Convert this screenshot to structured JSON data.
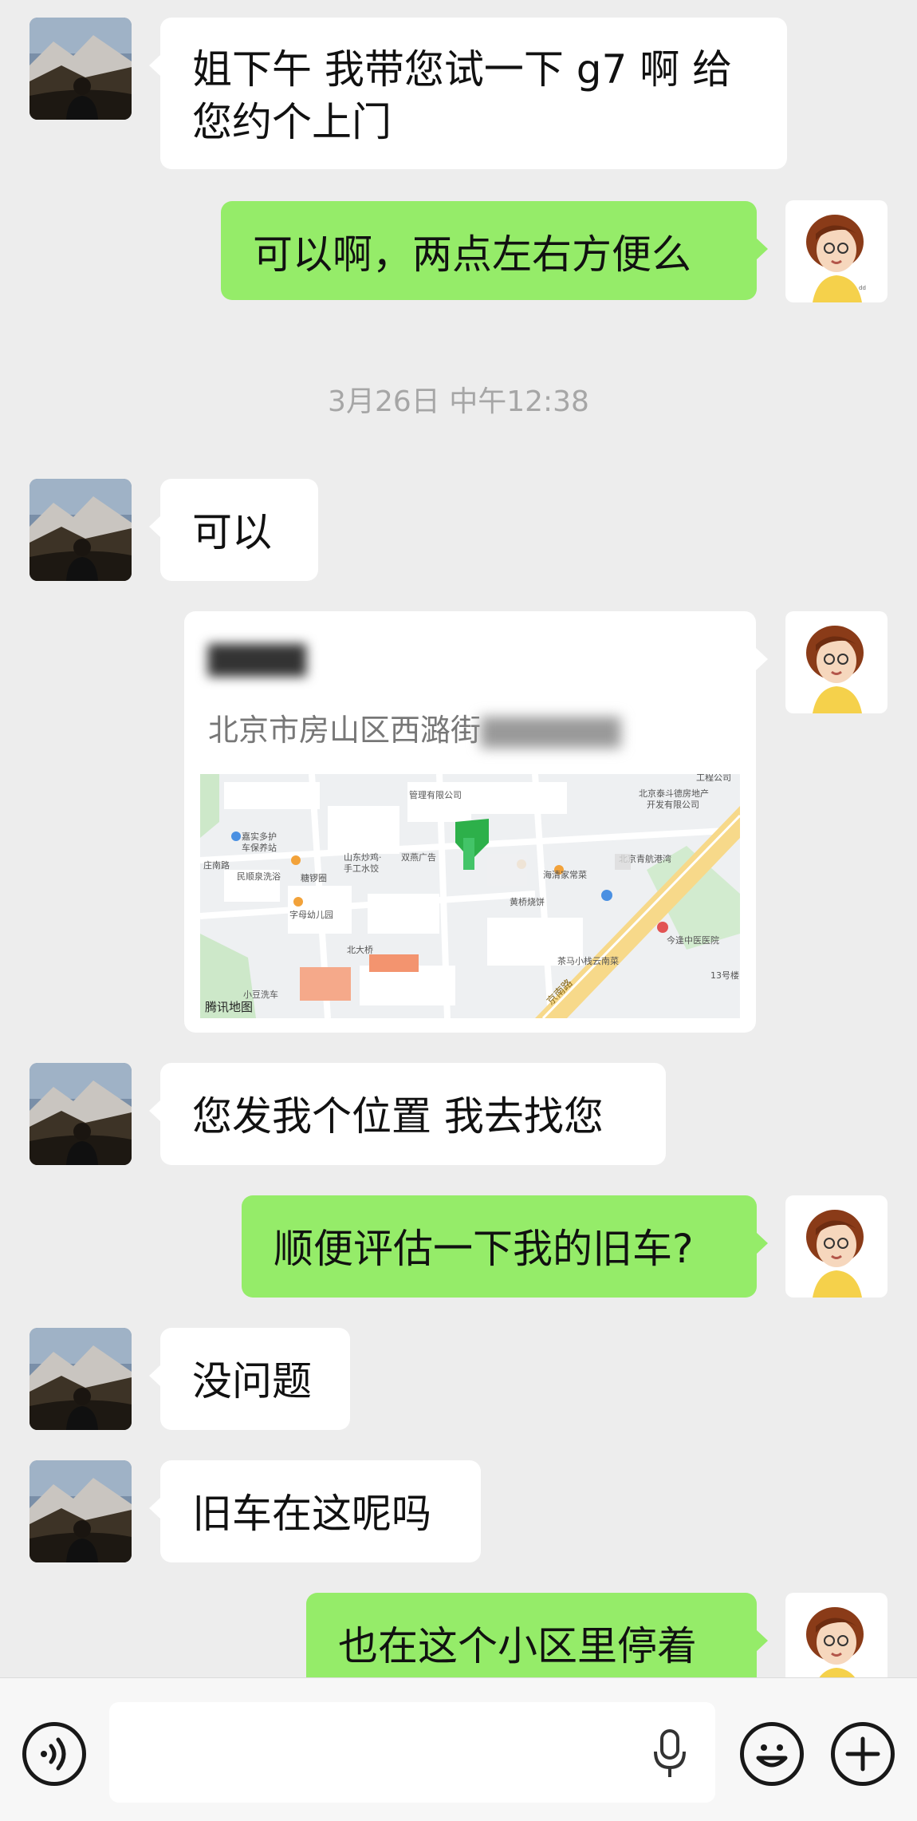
{
  "messages": [
    {
      "id": "m1",
      "side": "in",
      "text_line1": "姐下午 我带您试一下 g7 啊 给",
      "text_line2": "您约个上门"
    },
    {
      "id": "m2",
      "side": "out",
      "text": "可以啊，两点左右方便么"
    },
    {
      "id": "m3",
      "side": "in",
      "text": "可以"
    },
    {
      "id": "m4",
      "side": "out",
      "type": "location",
      "name": "▇▇▇▇",
      "address_visible": "北京市房山区西潞街",
      "address_hidden": "▇▇▇▇▇▇",
      "map_brand": "腾讯地图"
    },
    {
      "id": "m5",
      "side": "in",
      "text": "您发我个位置 我去找您"
    },
    {
      "id": "m6",
      "side": "out",
      "text": "顺便评估一下我的旧车?"
    },
    {
      "id": "m7",
      "side": "in",
      "text": "没问题"
    },
    {
      "id": "m8",
      "side": "in",
      "text": "旧车在这呢吗"
    },
    {
      "id": "m9",
      "side": "out",
      "text": "也在这个小区里停着"
    }
  ],
  "timestamp": "3月26日 中午12:38",
  "map_labels": {
    "l1": "管理有限公司",
    "l2": "嘉实多护\n车保养站",
    "l3": "庄南路",
    "l4": "民顺泉洗浴",
    "l5": "山东炒鸡·\n手工水饺",
    "l6": "双燕广告",
    "l7": "糖锣圈",
    "l8": "字母幼儿园",
    "l9": "北大桥",
    "l10": "小豆洗车",
    "l11": "工程公司",
    "l12": "北京泰斗德房地产\n开发有限公司",
    "l13": "海清家常菜",
    "l14": "黄桥烧饼",
    "l15": "茶马小栈云南菜",
    "l16": "今逢中医医院",
    "l17": "京南路",
    "l18": "北京青航港湾",
    "l19": "13号楼"
  },
  "input": {
    "placeholder": ""
  },
  "colors": {
    "out_bubble": "#95ec69",
    "in_bubble": "#ffffff",
    "background": "#ededed"
  }
}
